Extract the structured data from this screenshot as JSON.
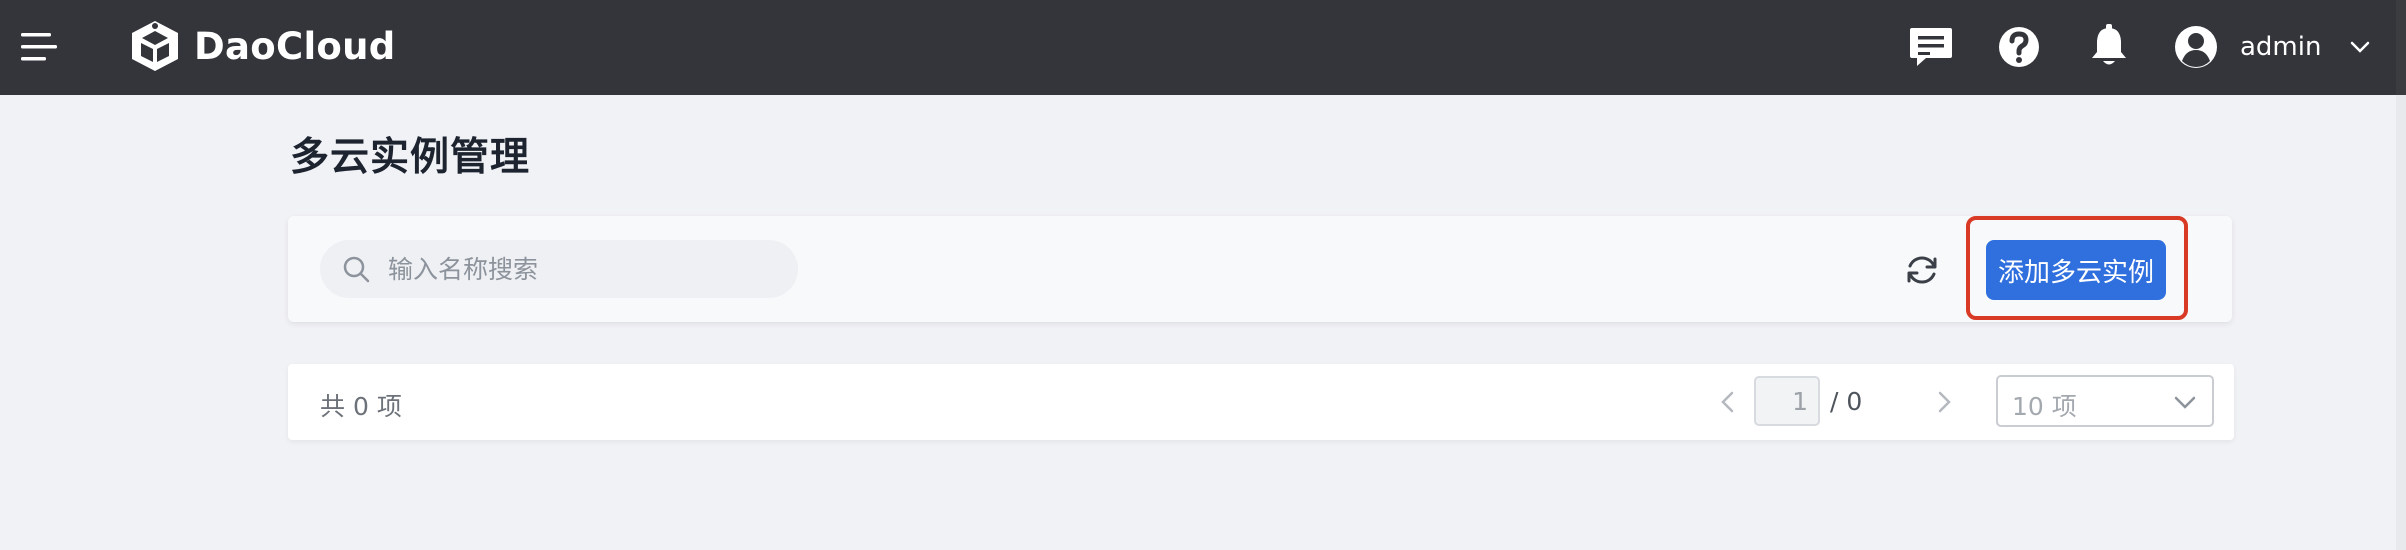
{
  "header": {
    "brand": "DaoCloud",
    "icons": [
      "menu-icon",
      "message-icon",
      "help-icon",
      "bell-icon",
      "user-avatar-icon",
      "chevron-down-icon"
    ],
    "user": {
      "name": "admin"
    }
  },
  "page": {
    "title": "多云实例管理"
  },
  "toolbar": {
    "search_placeholder": "输入名称搜索",
    "add_button_label": "添加多云实例",
    "highlight_color": "#d93a26",
    "accent_color": "#2f6fde"
  },
  "pagination": {
    "total_label": "共",
    "total_count": "0",
    "total_unit": "项",
    "current_page": "1",
    "page_total_text": "/ 0",
    "page_size_label": "10 项"
  }
}
